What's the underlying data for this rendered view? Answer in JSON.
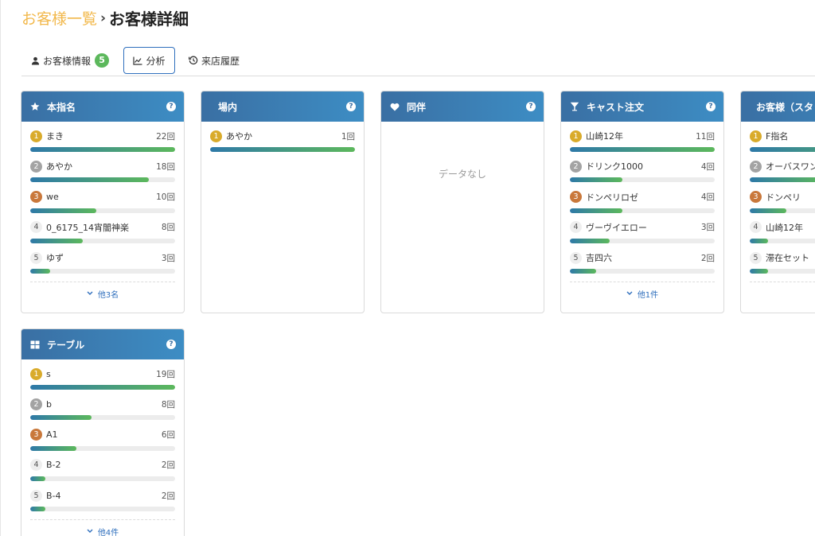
{
  "breadcrumb": {
    "parent": "お客様一覧",
    "separator": "›",
    "current": "お客様詳細"
  },
  "tabs": [
    {
      "label": "お客様情報",
      "badge": "5",
      "icon": "user-icon"
    },
    {
      "label": "分析",
      "icon": "chart-line-icon",
      "active": true
    },
    {
      "label": "来店履歴",
      "icon": "history-icon"
    }
  ],
  "colors": {
    "header_from": "#3a6fa3",
    "header_to": "#3d8dc4",
    "bar_from": "#2e79a8",
    "bar_to": "#5cb85c",
    "rank1": "#d9ab2b",
    "rank2": "#a3a3a3",
    "rank3": "#c9783b",
    "link": "#2f6fbd",
    "breadcrumb_link": "#f2b84b"
  },
  "cards": {
    "honshimei": {
      "title": "本指名",
      "icon": "star-icon",
      "items": [
        {
          "rank": "1",
          "name": "まき",
          "count": "22回",
          "ratio": 1.0
        },
        {
          "rank": "2",
          "name": "あやか",
          "count": "18回",
          "ratio": 0.818
        },
        {
          "rank": "3",
          "name": "we",
          "count": "10回",
          "ratio": 0.455
        },
        {
          "rank": "4",
          "name": "0_6175_14宵闇神楽",
          "count": "8回",
          "ratio": 0.364
        },
        {
          "rank": "5",
          "name": "ゆず",
          "count": "3回",
          "ratio": 0.136
        }
      ],
      "more": "他3名"
    },
    "jounai": {
      "title": "場内",
      "icon": "",
      "items": [
        {
          "rank": "1",
          "name": "あやか",
          "count": "1回",
          "ratio": 1.0
        }
      ]
    },
    "douhan": {
      "title": "同伴",
      "icon": "heart-icon",
      "empty": "データなし"
    },
    "cast_order": {
      "title": "キャスト注文",
      "icon": "cocktail-icon",
      "items": [
        {
          "rank": "1",
          "name": "山崎12年",
          "count": "11回",
          "ratio": 1.0
        },
        {
          "rank": "2",
          "name": "ドリンク1000",
          "count": "4回",
          "ratio": 0.364
        },
        {
          "rank": "3",
          "name": "ドンペリロゼ",
          "count": "4回",
          "ratio": 0.364
        },
        {
          "rank": "4",
          "name": "ヴーヴイエロー",
          "count": "3回",
          "ratio": 0.273
        },
        {
          "rank": "5",
          "name": "吉四六",
          "count": "2回",
          "ratio": 0.182
        }
      ],
      "more": "他1件"
    },
    "customer_order": {
      "title": "お客様（スタッフ注文）",
      "icon": "",
      "items": [
        {
          "rank": "1",
          "name": "F指名",
          "count": "",
          "ratio": 1.0
        },
        {
          "rank": "2",
          "name": "オーバスワン",
          "count": "",
          "ratio": 0.5
        },
        {
          "rank": "3",
          "name": "ドンペリ",
          "count": "",
          "ratio": 0.25
        },
        {
          "rank": "4",
          "name": "山崎12年",
          "count": "",
          "ratio": 0.125
        },
        {
          "rank": "5",
          "name": "滞在セット",
          "count": "",
          "ratio": 0.125
        }
      ],
      "more": ""
    },
    "table": {
      "title": "テーブル",
      "icon": "table-grid-icon",
      "items": [
        {
          "rank": "1",
          "name": "s",
          "count": "19回",
          "ratio": 1.0
        },
        {
          "rank": "2",
          "name": "b",
          "count": "8回",
          "ratio": 0.421
        },
        {
          "rank": "3",
          "name": "A1",
          "count": "6回",
          "ratio": 0.316
        },
        {
          "rank": "4",
          "name": "B-2",
          "count": "2回",
          "ratio": 0.105
        },
        {
          "rank": "5",
          "name": "B-4",
          "count": "2回",
          "ratio": 0.105
        }
      ],
      "more": "他4件"
    }
  },
  "help_glyph": "?"
}
